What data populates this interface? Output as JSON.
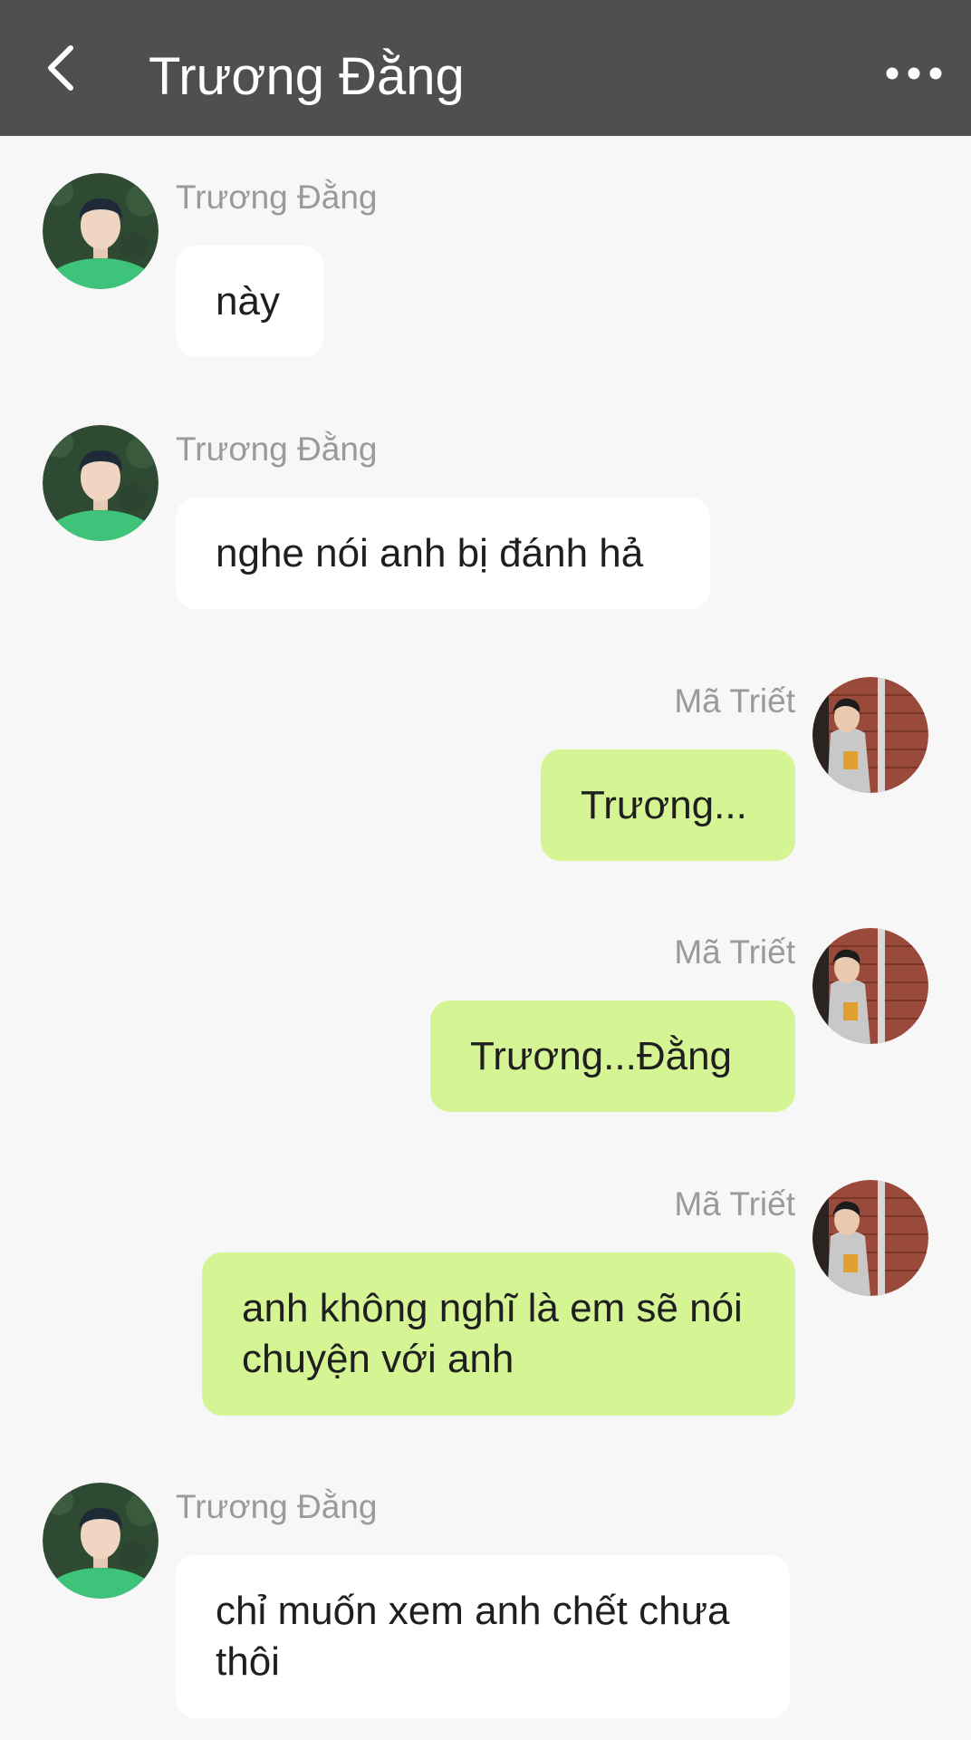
{
  "header": {
    "title": "Trương Đằng",
    "back_icon": "chevron-left-icon",
    "more_icon": "more-horizontal-icon"
  },
  "colors": {
    "header_bg": "#4f4f4f",
    "page_bg": "#f7f7f7",
    "incoming_bubble": "#ffffff",
    "outgoing_bubble": "#d5f594",
    "sender_name": "#9a9a9a"
  },
  "messages": [
    {
      "direction": "incoming",
      "sender": "Trương Đằng",
      "text": "này"
    },
    {
      "direction": "incoming",
      "sender": "Trương Đằng",
      "text": "nghe nói anh bị đánh hả"
    },
    {
      "direction": "outgoing",
      "sender": "Mã Triết",
      "text": "Trương..."
    },
    {
      "direction": "outgoing",
      "sender": "Mã Triết",
      "text": "Trương...Đằng"
    },
    {
      "direction": "outgoing",
      "sender": "Mã Triết",
      "text": "anh không nghĩ là em sẽ nói chuyện với anh"
    },
    {
      "direction": "incoming",
      "sender": "Trương Đằng",
      "text": "chỉ muốn xem anh chết chưa thôi"
    }
  ]
}
